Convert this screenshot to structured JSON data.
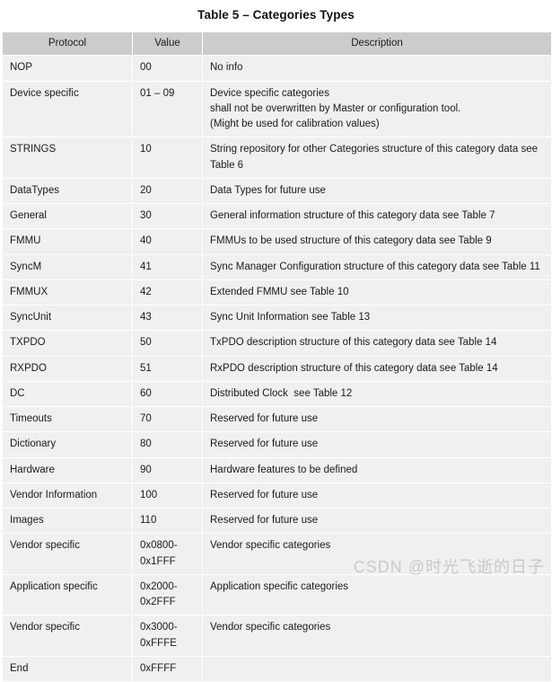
{
  "title": "Table 5 – Categories Types",
  "table": {
    "columns": [
      "Protocol",
      "Value",
      "Description"
    ],
    "rows": [
      {
        "protocol": "NOP",
        "value": "00",
        "description": "No info"
      },
      {
        "protocol": "Device specific",
        "value": "01 – 09",
        "description": "Device specific categories\nshall not be overwritten by Master or configuration tool.\n(Might be used for calibration values)"
      },
      {
        "protocol": "STRINGS",
        "value": "10",
        "description": "String repository for other Categories structure of this category data see Table 6"
      },
      {
        "protocol": "DataTypes",
        "value": "20",
        "description": "Data Types for future use"
      },
      {
        "protocol": "General",
        "value": "30",
        "description": "General information structure of this category data see Table 7"
      },
      {
        "protocol": "FMMU",
        "value": "40",
        "description": "FMMUs to be used structure of this category data see Table 9"
      },
      {
        "protocol": "SyncM",
        "value": "41",
        "description": "Sync Manager Configuration structure of this category data see Table 11"
      },
      {
        "protocol": "FMMUX",
        "value": "42",
        "description": "Extended FMMU see Table 10"
      },
      {
        "protocol": "SyncUnit",
        "value": "43",
        "description": "Sync Unit Information see Table 13"
      },
      {
        "protocol": "TXPDO",
        "value": "50",
        "description": "TxPDO description structure of this category data see Table 14"
      },
      {
        "protocol": "RXPDO",
        "value": "51",
        "description": "RxPDO description structure of this category data see Table 14"
      },
      {
        "protocol": "DC",
        "value": "60",
        "description": "Distributed Clock  see Table 12"
      },
      {
        "protocol": "Timeouts",
        "value": "70",
        "description": "Reserved for future use"
      },
      {
        "protocol": "Dictionary",
        "value": "80",
        "description": "Reserved for future use"
      },
      {
        "protocol": "Hardware",
        "value": "90",
        "description": "Hardware features to be defined"
      },
      {
        "protocol": "Vendor Information",
        "value": "100",
        "description": "Reserved for future use"
      },
      {
        "protocol": "Images",
        "value": "110",
        "description": "Reserved for future use"
      },
      {
        "protocol": "Vendor specific",
        "value": "0x0800-\n0x1FFF",
        "description": "Vendor specific categories"
      },
      {
        "protocol": "Application specific",
        "value": "0x2000-\n0x2FFF",
        "description": "Application specific categories"
      },
      {
        "protocol": "Vendor specific",
        "value": "0x3000-\n0xFFFE",
        "description": "Vendor specific categories"
      },
      {
        "protocol": "End",
        "value": "0xFFFF",
        "description": ""
      }
    ]
  },
  "watermark": "CSDN @时光飞逝的日子",
  "colors": {
    "header_bg": "#cccccc",
    "cell_bg": "#f0f0f0",
    "page_bg": "#ffffff",
    "text": "#1a1a1a",
    "watermark": "#c9c9c9"
  }
}
